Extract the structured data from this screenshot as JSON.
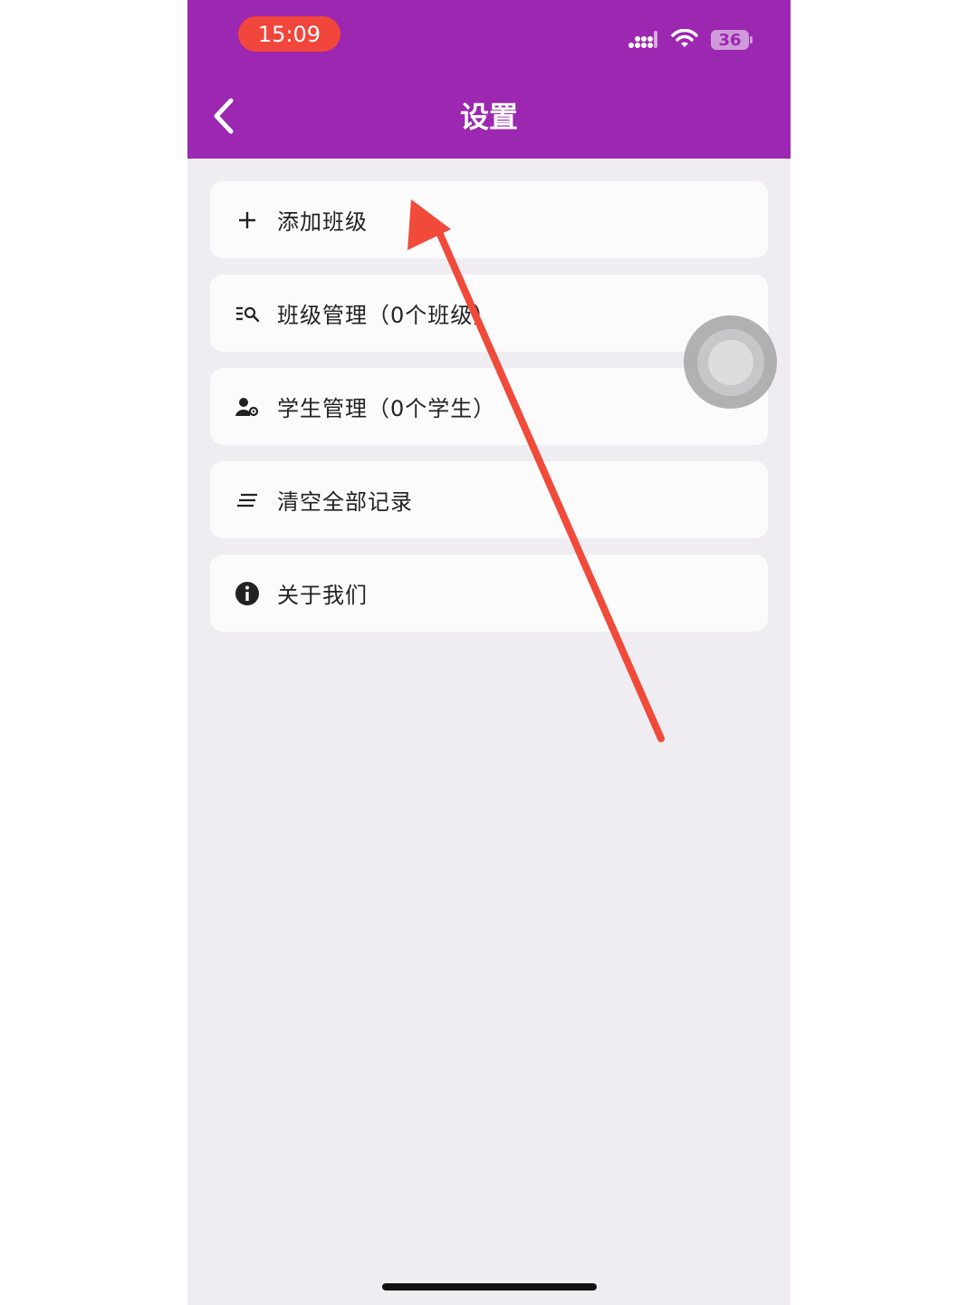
{
  "status_bar": {
    "time": "15:09",
    "battery": "36",
    "icons": [
      "signal-icon",
      "wifi-icon",
      "battery-icon"
    ]
  },
  "header": {
    "title": "设置",
    "back_icon": "chevron-left-icon"
  },
  "menu": {
    "items": [
      {
        "label": "添加班级",
        "icon": "plus-icon"
      },
      {
        "label": "班级管理（0个班级）",
        "icon": "list-search-icon"
      },
      {
        "label": "学生管理（0个学生）",
        "icon": "user-settings-icon"
      },
      {
        "label": "清空全部记录",
        "icon": "clear-all-icon"
      },
      {
        "label": "关于我们",
        "icon": "info-icon"
      }
    ]
  },
  "colors": {
    "appbar": "#9c27b0",
    "time_pill": "#f0463b",
    "background": "#efedf1",
    "card": "#fbfbfc",
    "annotation_arrow": "#f04a3a"
  }
}
